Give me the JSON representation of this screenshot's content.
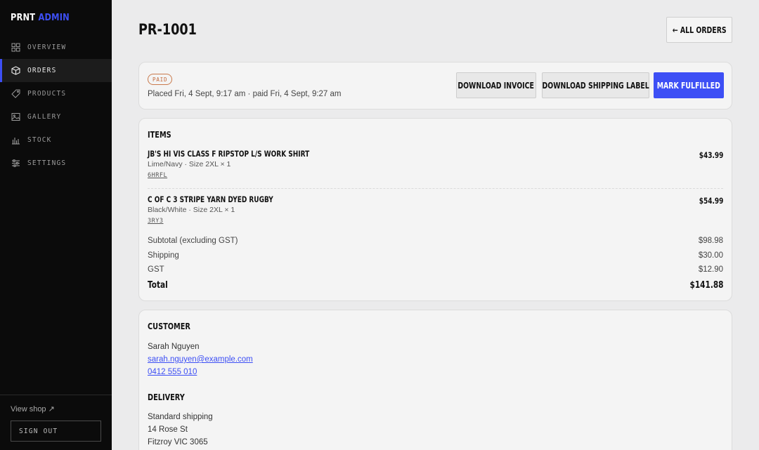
{
  "brand": {
    "part1": "PRNT",
    "part2": "ADMIN"
  },
  "colors": {
    "accent": "#3d4ff5",
    "sidebar_bg": "#0b0b0b",
    "paid_badge": "#c2683a"
  },
  "sidebar": {
    "items": [
      {
        "label": "OVERVIEW",
        "icon": "grid-icon",
        "active": false
      },
      {
        "label": "ORDERS",
        "icon": "box-icon",
        "active": true
      },
      {
        "label": "PRODUCTS",
        "icon": "tag-icon",
        "active": false
      },
      {
        "label": "GALLERY",
        "icon": "image-icon",
        "active": false
      },
      {
        "label": "STOCK",
        "icon": "bar-chart-icon",
        "active": false
      },
      {
        "label": "SETTINGS",
        "icon": "sliders-icon",
        "active": false
      }
    ],
    "view_shop": "View shop ↗",
    "sign_out": "SIGN OUT"
  },
  "header": {
    "title": "PR-1001",
    "back_button": "← ALL ORDERS"
  },
  "status": {
    "badge": "PAID",
    "placed_text": "Placed Fri, 4 Sept, 9:17 am · paid Fri, 4 Sept, 9:27 am",
    "buttons": {
      "invoice": "DOWNLOAD INVOICE",
      "shipping_label": "DOWNLOAD SHIPPING LABEL",
      "fulfill": "MARK FULFILLED"
    }
  },
  "items_section": {
    "heading": "ITEMS",
    "items": [
      {
        "name": "JB'S HI VIS CLASS F RIPSTOP L/S WORK SHIRT",
        "variant": "Lime/Navy · Size 2XL × 1",
        "sku": "6HRFL",
        "price": "$43.99"
      },
      {
        "name": "C OF C 3 STRIPE YARN DYED RUGBY",
        "variant": "Black/White · Size 2XL × 1",
        "sku": "3RY3",
        "price": "$54.99"
      }
    ],
    "summary": [
      {
        "label": "Subtotal (excluding GST)",
        "value": "$98.98"
      },
      {
        "label": "Shipping",
        "value": "$30.00"
      },
      {
        "label": "GST",
        "value": "$12.90"
      }
    ],
    "total_label": "Total",
    "total_value": "$141.88"
  },
  "customer": {
    "heading": "CUSTOMER",
    "name": "Sarah Nguyen",
    "email": "sarah.nguyen@example.com",
    "phone": "0412 555 010"
  },
  "delivery": {
    "heading": "DELIVERY",
    "method": "Standard shipping",
    "address_line1": "14 Rose St",
    "address_line2": "Fitzroy VIC 3065"
  }
}
